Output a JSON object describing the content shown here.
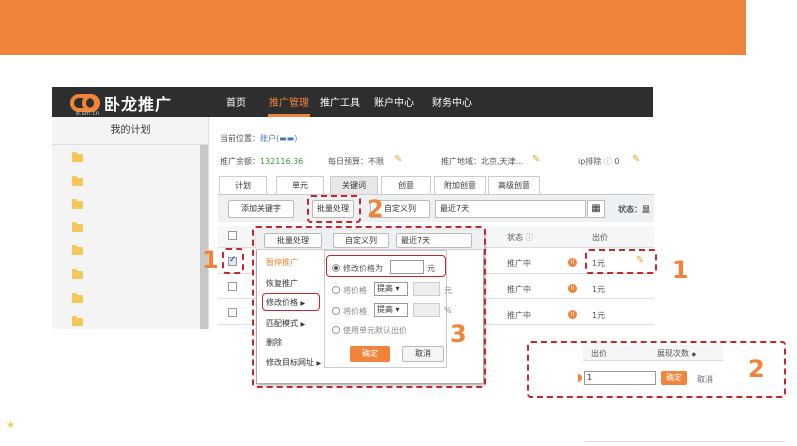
{
  "logo": {
    "brand": "卧龙推广",
    "sub": "e.sm.cn"
  },
  "nav": {
    "items": [
      "首页",
      "推广管理",
      "推广工具",
      "账户中心",
      "财务中心"
    ],
    "active": "推广管理"
  },
  "sidebar": {
    "title": "我的计划"
  },
  "breadcrumb": {
    "label": "当前位置：",
    "account": "账户(▬▬)"
  },
  "stats": {
    "balance_label": "推广余额：",
    "balance_value": "132116.36",
    "budget_label": "每日预算：不限",
    "region_label": "推广地域：北京,天津...",
    "ip_label": "ip排除",
    "ip_value": "0"
  },
  "tabs": [
    "计划",
    "单元",
    "关键词",
    "创意",
    "附加创意",
    "高级创意"
  ],
  "toolbar": {
    "add_keyword": "添加关键字",
    "batch": "批量处理",
    "custom_cols": "自定义列",
    "date_range": "最近7天",
    "status_label": "状态：显"
  },
  "table": {
    "header_status": "状态",
    "header_bid": "出价",
    "rows": [
      {
        "status": "推广中",
        "bid": "1元"
      },
      {
        "status": "推广中",
        "bid": "1元"
      },
      {
        "status": "推广中",
        "bid": "1元"
      }
    ]
  },
  "popup": {
    "tabs": [
      "批量处理",
      "自定义列",
      "最近7天"
    ],
    "menu": [
      "暂停推广",
      "恢复推广",
      "修改价格",
      "匹配模式",
      "删除",
      "修改目标网址"
    ],
    "options": {
      "opt1_label": "修改价格为",
      "opt1_unit": "元",
      "opt2_label": "将价格",
      "opt2_select": "提高",
      "opt2_unit": "元",
      "opt3_label": "将价格",
      "opt3_select": "提高",
      "opt3_unit": "%",
      "opt4_label": "使用单元默认出价"
    },
    "confirm": "确定",
    "cancel": "取消"
  },
  "inline_edit": {
    "header_bid": "出价",
    "header_count": "展现次数",
    "value": "1",
    "confirm": "确定",
    "cancel": "取消"
  },
  "annotations": {
    "n1": "1",
    "n2": "2",
    "n3": "3"
  },
  "colors": {
    "accent": "#f0843a",
    "annotation_red": "#c8262c",
    "nav_bg": "#2e2e2e"
  }
}
